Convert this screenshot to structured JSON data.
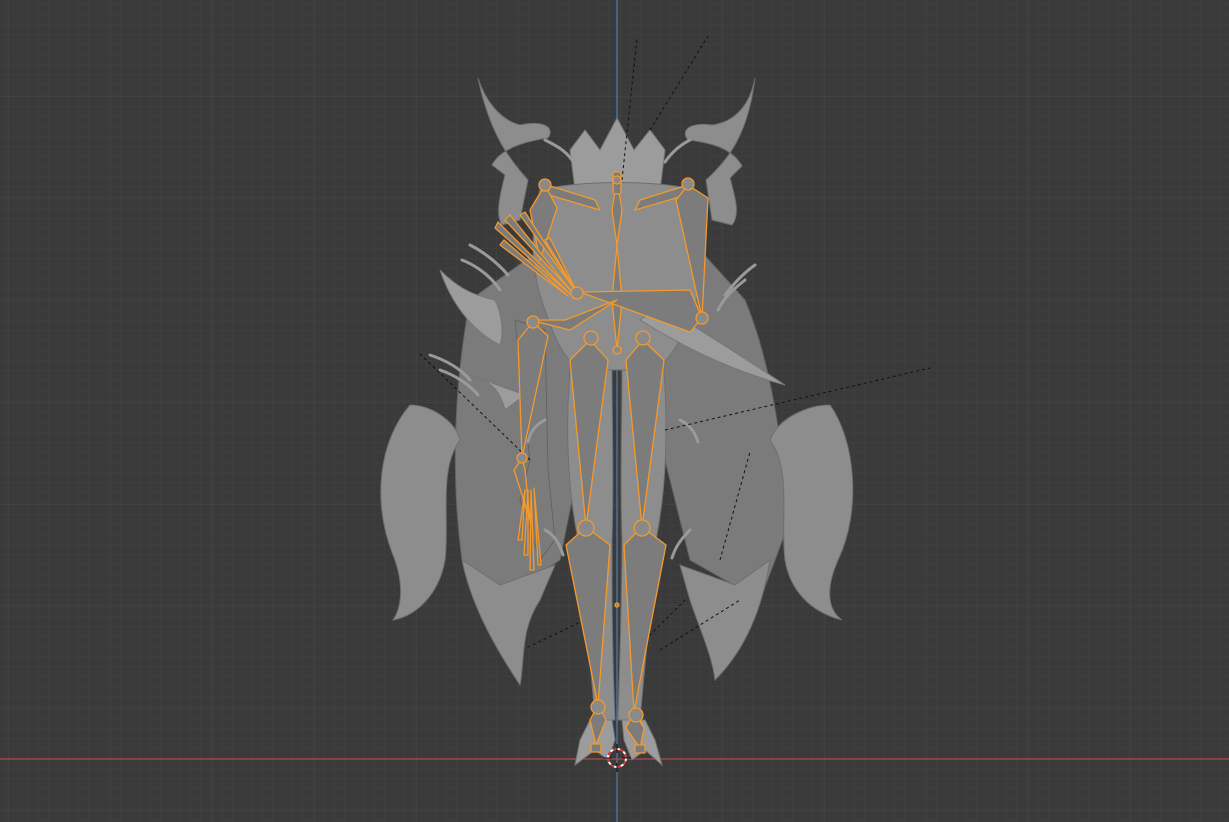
{
  "viewport": {
    "background_color": "#3a3a3a",
    "grid_minor_color": "#414141",
    "grid_major_color": "#4a4a4a",
    "x_axis_color": "#b04848",
    "z_axis_color": "#4a7fb0",
    "bone_outline_color": "#f39a2c",
    "mesh_color": "#8d8d8d"
  },
  "scene": {
    "object": "character-mesh",
    "armature": "character-armature",
    "cursor_icon": "3d-cursor-icon"
  }
}
